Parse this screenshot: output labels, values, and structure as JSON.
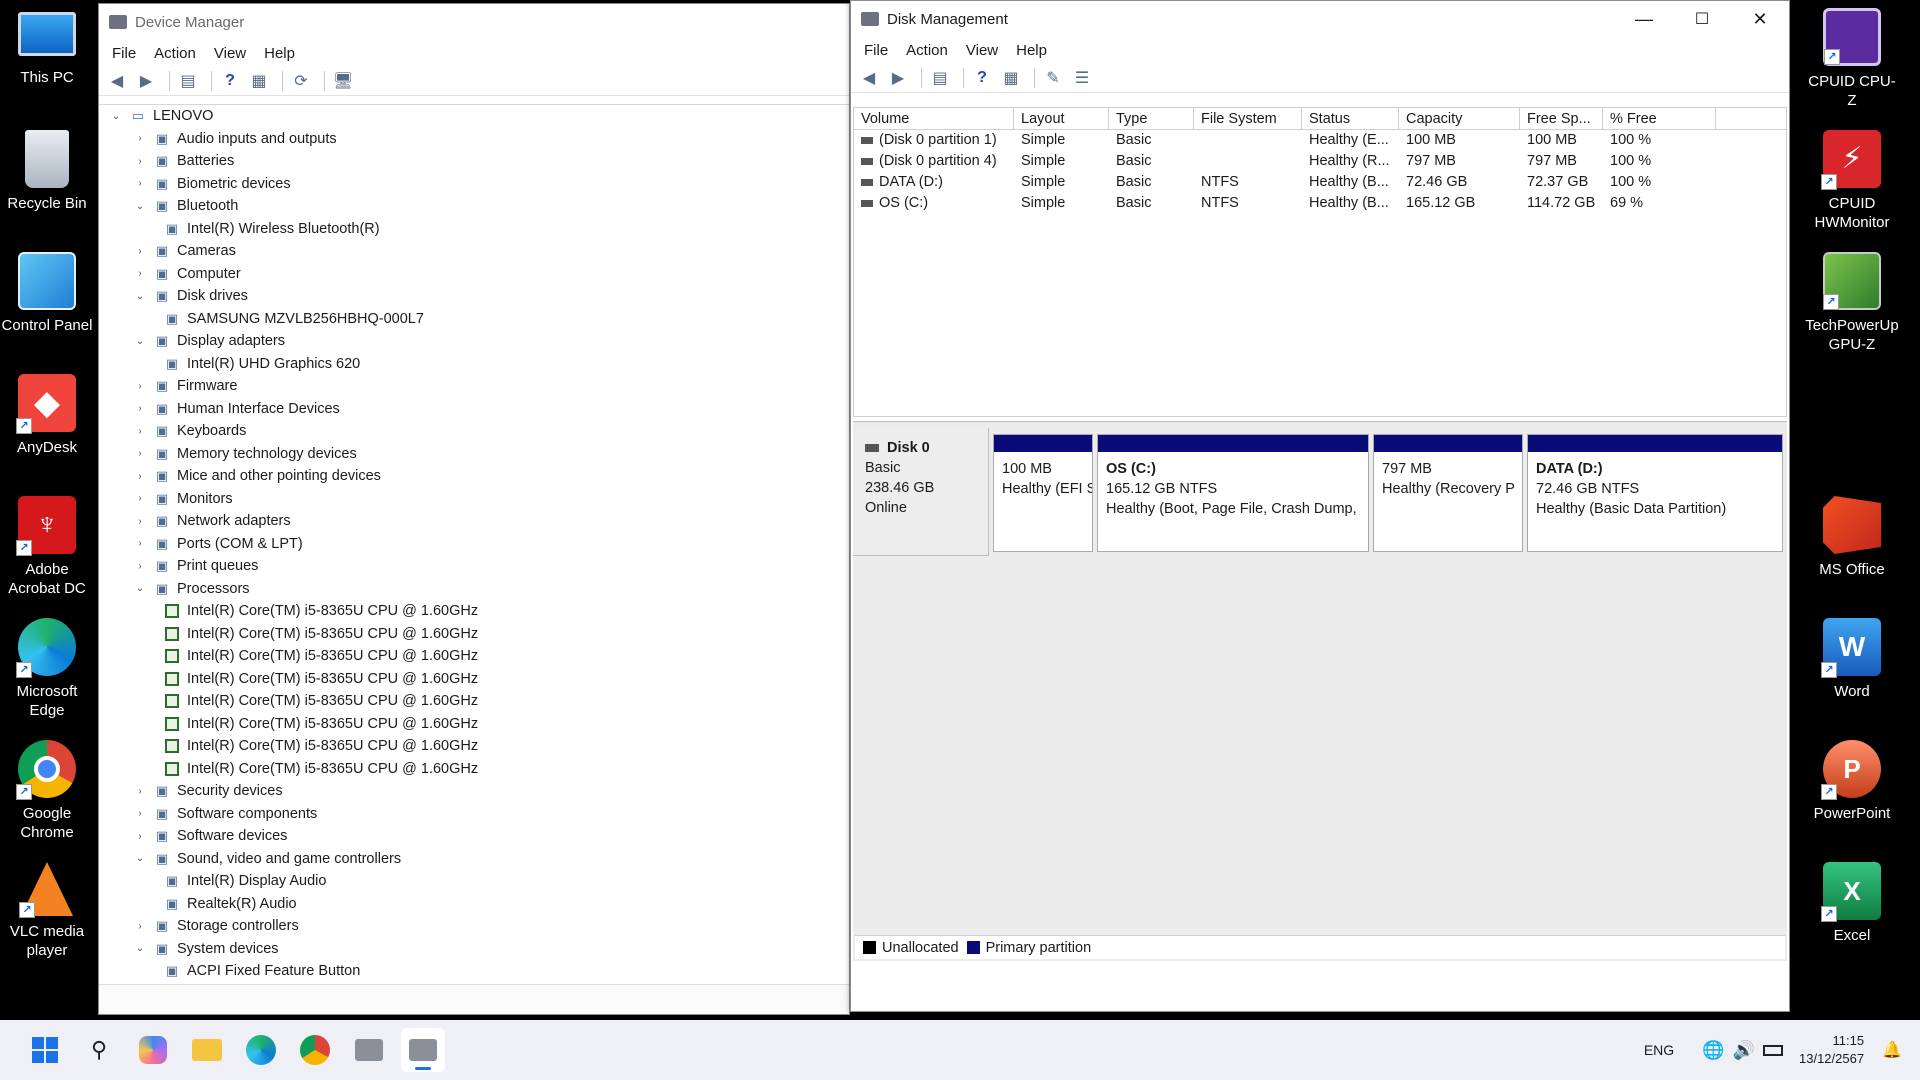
{
  "desktop_left": [
    "This PC",
    "Recycle Bin",
    "Control Panel",
    "AnyDesk",
    "Adobe Acrobat DC",
    "Microsoft Edge",
    "Google Chrome",
    "VLC media player"
  ],
  "desktop_right": [
    "CPUID CPU-Z",
    "CPUID HWMonitor",
    "TechPowerUp GPU-Z",
    "MS Office",
    "Word",
    "PowerPoint",
    "Excel"
  ],
  "device_manager": {
    "title": "Device Manager",
    "menu": [
      "File",
      "Action",
      "View",
      "Help"
    ],
    "root": "LENOVO",
    "tree": [
      {
        "label": "Audio inputs and outputs",
        "level": 1,
        "expanded": false
      },
      {
        "label": "Batteries",
        "level": 1,
        "expanded": false
      },
      {
        "label": "Biometric devices",
        "level": 1,
        "expanded": false
      },
      {
        "label": "Bluetooth",
        "level": 1,
        "expanded": true
      },
      {
        "label": "Intel(R) Wireless Bluetooth(R)",
        "level": 2
      },
      {
        "label": "Cameras",
        "level": 1,
        "expanded": false
      },
      {
        "label": "Computer",
        "level": 1,
        "expanded": false
      },
      {
        "label": "Disk drives",
        "level": 1,
        "expanded": true
      },
      {
        "label": "SAMSUNG MZVLB256HBHQ-000L7",
        "level": 2
      },
      {
        "label": "Display adapters",
        "level": 1,
        "expanded": true
      },
      {
        "label": "Intel(R) UHD Graphics 620",
        "level": 2
      },
      {
        "label": "Firmware",
        "level": 1,
        "expanded": false
      },
      {
        "label": "Human Interface Devices",
        "level": 1,
        "expanded": false
      },
      {
        "label": "Keyboards",
        "level": 1,
        "expanded": false
      },
      {
        "label": "Memory technology devices",
        "level": 1,
        "expanded": false
      },
      {
        "label": "Mice and other pointing devices",
        "level": 1,
        "expanded": false
      },
      {
        "label": "Monitors",
        "level": 1,
        "expanded": false
      },
      {
        "label": "Network adapters",
        "level": 1,
        "expanded": false
      },
      {
        "label": "Ports (COM & LPT)",
        "level": 1,
        "expanded": false
      },
      {
        "label": "Print queues",
        "level": 1,
        "expanded": false
      },
      {
        "label": "Processors",
        "level": 1,
        "expanded": true
      },
      {
        "label": "Intel(R) Core(TM) i5-8365U CPU @ 1.60GHz",
        "level": 2,
        "cpu": true
      },
      {
        "label": "Intel(R) Core(TM) i5-8365U CPU @ 1.60GHz",
        "level": 2,
        "cpu": true
      },
      {
        "label": "Intel(R) Core(TM) i5-8365U CPU @ 1.60GHz",
        "level": 2,
        "cpu": true
      },
      {
        "label": "Intel(R) Core(TM) i5-8365U CPU @ 1.60GHz",
        "level": 2,
        "cpu": true
      },
      {
        "label": "Intel(R) Core(TM) i5-8365U CPU @ 1.60GHz",
        "level": 2,
        "cpu": true
      },
      {
        "label": "Intel(R) Core(TM) i5-8365U CPU @ 1.60GHz",
        "level": 2,
        "cpu": true
      },
      {
        "label": "Intel(R) Core(TM) i5-8365U CPU @ 1.60GHz",
        "level": 2,
        "cpu": true
      },
      {
        "label": "Intel(R) Core(TM) i5-8365U CPU @ 1.60GHz",
        "level": 2,
        "cpu": true
      },
      {
        "label": "Security devices",
        "level": 1,
        "expanded": false
      },
      {
        "label": "Software components",
        "level": 1,
        "expanded": false
      },
      {
        "label": "Software devices",
        "level": 1,
        "expanded": false
      },
      {
        "label": "Sound, video and game controllers",
        "level": 1,
        "expanded": true
      },
      {
        "label": "Intel(R) Display Audio",
        "level": 2
      },
      {
        "label": "Realtek(R) Audio",
        "level": 2
      },
      {
        "label": "Storage controllers",
        "level": 1,
        "expanded": false
      },
      {
        "label": "System devices",
        "level": 1,
        "expanded": true
      },
      {
        "label": "ACPI Fixed Feature Button",
        "level": 2
      }
    ]
  },
  "disk_management": {
    "title": "Disk Management",
    "menu": [
      "File",
      "Action",
      "View",
      "Help"
    ],
    "columns": [
      "Volume",
      "Layout",
      "Type",
      "File System",
      "Status",
      "Capacity",
      "Free Sp...",
      "% Free"
    ],
    "rows": [
      [
        "(Disk 0 partition 1)",
        "Simple",
        "Basic",
        "",
        "Healthy (E...",
        "100 MB",
        "100 MB",
        "100 %"
      ],
      [
        "(Disk 0 partition 4)",
        "Simple",
        "Basic",
        "",
        "Healthy (R...",
        "797 MB",
        "797 MB",
        "100 %"
      ],
      [
        "DATA (D:)",
        "Simple",
        "Basic",
        "NTFS",
        "Healthy (B...",
        "72.46 GB",
        "72.37 GB",
        "100 %"
      ],
      [
        "OS (C:)",
        "Simple",
        "Basic",
        "NTFS",
        "Healthy (B...",
        "165.12 GB",
        "114.72 GB",
        "69 %"
      ]
    ],
    "disk": {
      "name": "Disk 0",
      "type": "Basic",
      "size": "238.46 GB",
      "status": "Online"
    },
    "partitions": [
      {
        "title": "",
        "size": "100 MB",
        "status": "Healthy (EFI S"
      },
      {
        "title": "OS  (C:)",
        "size": "165.12 GB NTFS",
        "status": "Healthy (Boot, Page File, Crash Dump,"
      },
      {
        "title": "",
        "size": "797 MB",
        "status": "Healthy (Recovery P"
      },
      {
        "title": "DATA  (D:)",
        "size": "72.46 GB NTFS",
        "status": "Healthy (Basic Data Partition)"
      }
    ],
    "legend": [
      "Unallocated",
      "Primary partition"
    ],
    "colors": {
      "unallocated": "#000000",
      "primary": "#0a0a78"
    }
  },
  "taskbar": {
    "lang": "ENG",
    "time": "11:15",
    "date": "13/12/2567"
  }
}
